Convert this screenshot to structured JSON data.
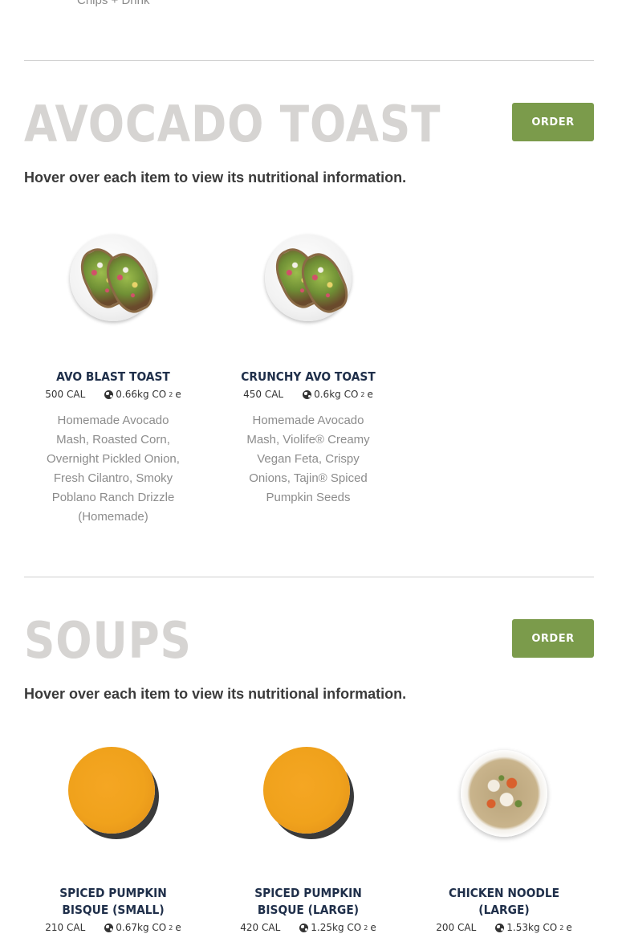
{
  "top_fragment": "Chips + Drink",
  "sections": [
    {
      "title": "AVOCADO TOAST",
      "order_label": "ORDER",
      "hover_note": "Hover over each item to view its nutritional information.",
      "items": [
        {
          "name": "AVO BLAST TOAST",
          "calories": "500 CAL",
          "co2": "0.66kg CO",
          "co2_suffix": "e",
          "description": "Homemade Avocado Mash, Roasted Corn, Overnight Pickled Onion, Fresh Cilantro, Smoky Poblano Ranch Drizzle (Homemade)",
          "photo_icon": "avocado-toast-photo"
        },
        {
          "name": "CRUNCHY AVO TOAST",
          "calories": "450 CAL",
          "co2": "0.6kg CO",
          "co2_suffix": "e",
          "description": "Homemade Avocado Mash, Violife® Creamy Vegan Feta, Crispy Onions, Tajin® Spiced Pumpkin Seeds",
          "photo_icon": "avocado-toast-photo"
        }
      ]
    },
    {
      "title": "SOUPS",
      "order_label": "ORDER",
      "hover_note": "Hover over each item to view its nutritional information.",
      "items": [
        {
          "name": "SPICED PUMPKIN BISQUE (SMALL)",
          "calories": "210 CAL",
          "co2": "0.67kg CO",
          "co2_suffix": "e",
          "photo_icon": "pumpkin-bisque-photo"
        },
        {
          "name": "SPICED PUMPKIN BISQUE (LARGE)",
          "calories": "420 CAL",
          "co2": "1.25kg CO",
          "co2_suffix": "e",
          "photo_icon": "pumpkin-bisque-photo"
        },
        {
          "name": "CHICKEN NOODLE (LARGE)",
          "calories": "200 CAL",
          "co2": "1.53kg CO",
          "co2_suffix": "e",
          "photo_icon": "chicken-noodle-soup-photo"
        }
      ]
    }
  ],
  "co2_subscript": "2",
  "colors": {
    "order_button": "#7b9b4b",
    "section_title": "#d6d4d2",
    "item_name": "#1f2f4a",
    "description": "#8c8c8c"
  }
}
